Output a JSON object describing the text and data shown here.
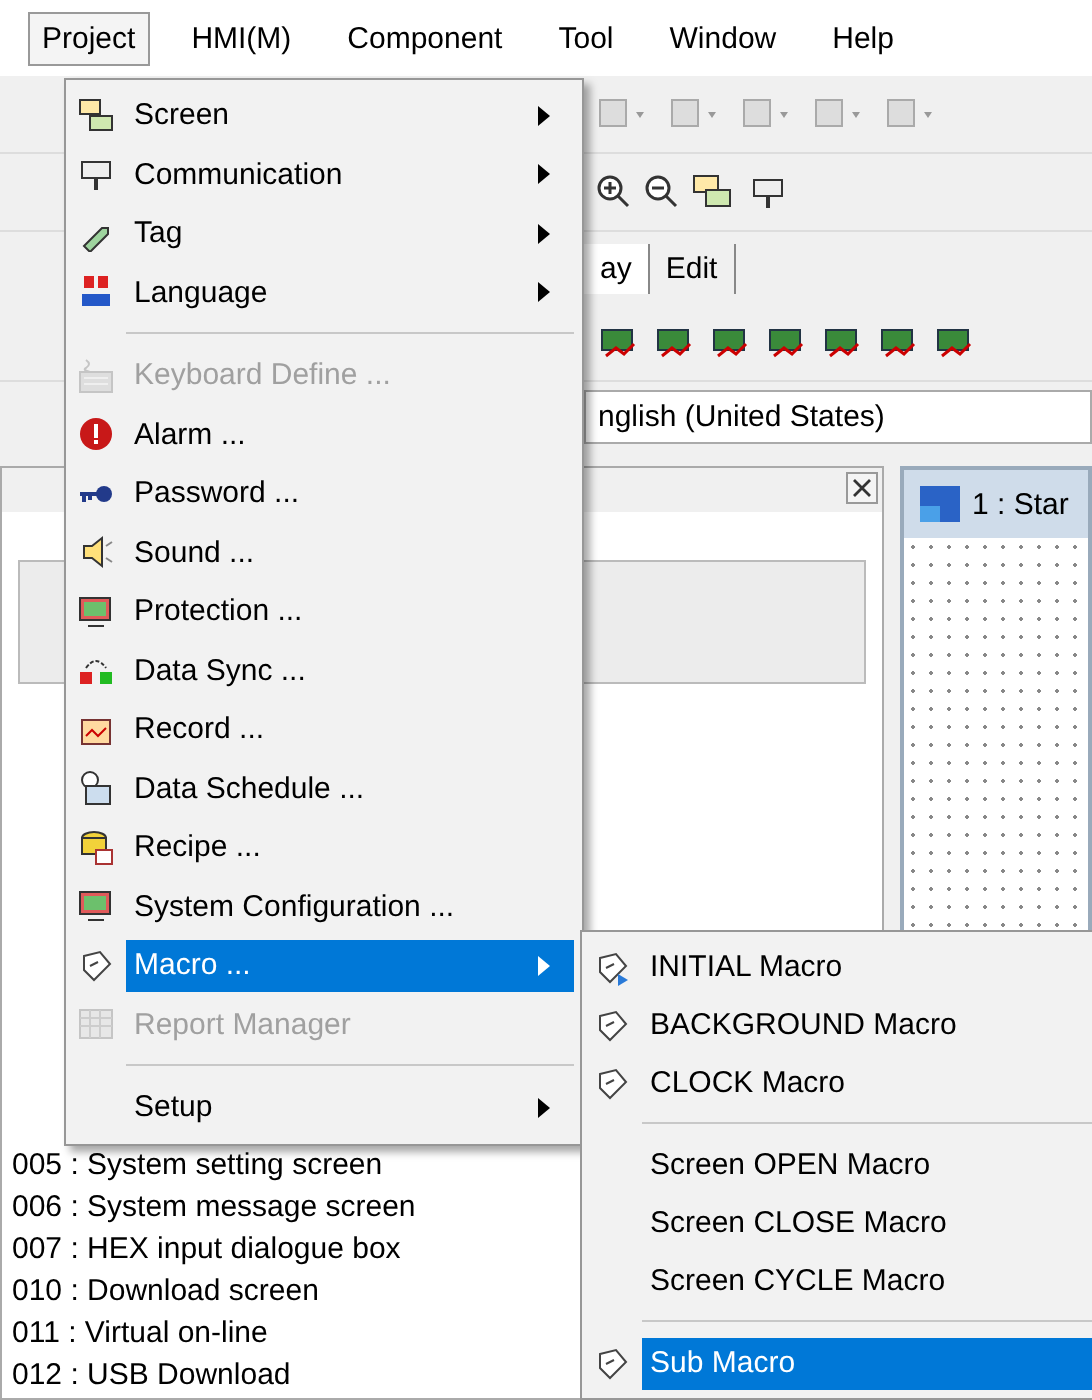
{
  "menubar": [
    {
      "label": "Project",
      "selected": true
    },
    {
      "label": "HMI(M)",
      "selected": false
    },
    {
      "label": "Component",
      "selected": false
    },
    {
      "label": "Tool",
      "selected": false
    },
    {
      "label": "Window",
      "selected": false
    },
    {
      "label": "Help",
      "selected": false
    }
  ],
  "tabs": [
    {
      "label": "ay",
      "selected": true
    },
    {
      "label": "Edit",
      "selected": false
    }
  ],
  "language_field": {
    "value": "nglish (United States)"
  },
  "screen_window": {
    "title": "1 : Star"
  },
  "screen_list": [
    "005 : System setting screen",
    "006 : System message screen",
    "007 : HEX input dialogue box",
    "010 : Download screen",
    "011 : Virtual on-line",
    "012 : USB Download"
  ],
  "menu": [
    {
      "kind": "item",
      "label": "Screen",
      "submenu": true,
      "disabled": false,
      "selected": false
    },
    {
      "kind": "item",
      "label": "Communication",
      "submenu": true,
      "disabled": false,
      "selected": false
    },
    {
      "kind": "item",
      "label": "Tag",
      "submenu": true,
      "disabled": false,
      "selected": false
    },
    {
      "kind": "item",
      "label": "Language",
      "submenu": true,
      "disabled": false,
      "selected": false
    },
    {
      "kind": "separator"
    },
    {
      "kind": "item",
      "label": "Keyboard Define ...",
      "submenu": false,
      "disabled": true,
      "selected": false
    },
    {
      "kind": "item",
      "label": "Alarm ...",
      "submenu": false,
      "disabled": false,
      "selected": false
    },
    {
      "kind": "item",
      "label": "Password ...",
      "submenu": false,
      "disabled": false,
      "selected": false
    },
    {
      "kind": "item",
      "label": "Sound ...",
      "submenu": false,
      "disabled": false,
      "selected": false
    },
    {
      "kind": "item",
      "label": "Protection ...",
      "submenu": false,
      "disabled": false,
      "selected": false
    },
    {
      "kind": "item",
      "label": "Data Sync ...",
      "submenu": false,
      "disabled": false,
      "selected": false
    },
    {
      "kind": "item",
      "label": "Record ...",
      "submenu": false,
      "disabled": false,
      "selected": false
    },
    {
      "kind": "item",
      "label": "Data Schedule ...",
      "submenu": false,
      "disabled": false,
      "selected": false
    },
    {
      "kind": "item",
      "label": "Recipe ...",
      "submenu": false,
      "disabled": false,
      "selected": false
    },
    {
      "kind": "item",
      "label": "System Configuration ...",
      "submenu": false,
      "disabled": false,
      "selected": false
    },
    {
      "kind": "item",
      "label": "Macro ...",
      "submenu": true,
      "disabled": false,
      "selected": true
    },
    {
      "kind": "item",
      "label": "Report Manager",
      "submenu": false,
      "disabled": true,
      "selected": false
    },
    {
      "kind": "separator"
    },
    {
      "kind": "item",
      "label": "Setup",
      "submenu": true,
      "disabled": false,
      "selected": false
    }
  ],
  "submenu": [
    {
      "kind": "item",
      "label": "INITIAL Macro",
      "selected": false
    },
    {
      "kind": "item",
      "label": "BACKGROUND Macro",
      "selected": false
    },
    {
      "kind": "item",
      "label": "CLOCK Macro",
      "selected": false
    },
    {
      "kind": "separator"
    },
    {
      "kind": "item",
      "label": "Screen OPEN Macro",
      "selected": false
    },
    {
      "kind": "item",
      "label": "Screen CLOSE Macro",
      "selected": false
    },
    {
      "kind": "item",
      "label": "Screen CYCLE Macro",
      "selected": false
    },
    {
      "kind": "separator"
    },
    {
      "kind": "item",
      "label": "Sub Macro",
      "selected": true
    }
  ]
}
